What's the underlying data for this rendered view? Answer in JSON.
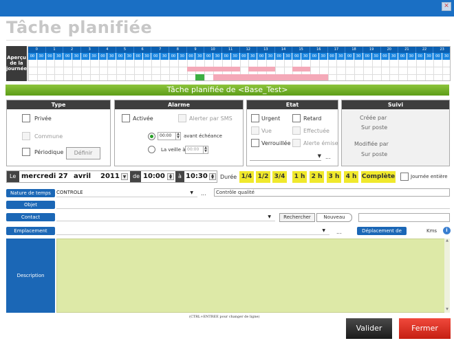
{
  "window": {
    "title": "Tâche planifiée",
    "close_icon": "close-icon"
  },
  "timeline": {
    "label": "Aperçu de la journée",
    "hours": [
      "0",
      "1",
      "2",
      "3",
      "4",
      "5",
      "6",
      "7",
      "8",
      "9",
      "10",
      "11",
      "12",
      "13",
      "14",
      "15",
      "16",
      "17",
      "18",
      "19",
      "20",
      "21",
      "22",
      "23"
    ],
    "minutes": [
      "00",
      "30"
    ],
    "busy_blocks": [
      {
        "start": 9.0,
        "end": 12.0,
        "row": 1,
        "color": "#f4a9b8"
      },
      {
        "start": 12.5,
        "end": 14.0,
        "row": 1,
        "color": "#f4a9b8"
      },
      {
        "start": 15.0,
        "end": 16.0,
        "row": 1,
        "color": "#f4a9b8"
      },
      {
        "start": 10.5,
        "end": 17.0,
        "row": 2,
        "color": "#f4a9b8"
      },
      {
        "start": 9.5,
        "end": 10.0,
        "row": 2,
        "color": "#3cb043"
      }
    ]
  },
  "header_band": "Tâche planifiée de <Base_Test>",
  "type_panel": {
    "title": "Type",
    "privee": "Privée",
    "commune": "Commune",
    "periodique": "Périodique",
    "definir": "Définir"
  },
  "alarme_panel": {
    "title": "Alarme",
    "activee": "Activée",
    "alerter_sms": "Alerter par SMS",
    "time_value": "00:00",
    "avant_echeance": "avant échéance",
    "veille": "La veille à",
    "veille_time": "00:00"
  },
  "etat_panel": {
    "title": "Etat",
    "urgent": "Urgent",
    "retard": "Retard",
    "vue": "Vue",
    "effectuee": "Effectuée",
    "verrouillee": "Verrouillée",
    "alerte_emise": "Alerte émise",
    "ellipsis": "..."
  },
  "suivi_panel": {
    "title": "Suivi",
    "creee_par": "Créée par",
    "sur_poste_1": "Sur poste",
    "modifiee_par": "Modifiée par",
    "sur_poste_2": "Sur poste"
  },
  "date_bar": {
    "le": "Le",
    "day": "mercredi 27",
    "month": "avril",
    "year": "2011",
    "de": "de",
    "start": "10:00",
    "a": "à",
    "end": "10:30"
  },
  "duree": {
    "label": "Durée",
    "options": [
      "1/4",
      "1/2",
      "3/4",
      "1 h",
      "2 h",
      "3 h",
      "4 h",
      "Complète"
    ],
    "journee_entiere": "Journée entière"
  },
  "fields": {
    "nature_label": "Nature de temps",
    "nature_value": "CONTROLE",
    "nature_detail": "Contrôle qualité",
    "objet_label": "Objet",
    "contact_label": "Contact",
    "rechercher": "Rechercher",
    "nouveau": "Nouveau",
    "emplacement_label": "Emplacement",
    "deplacement": "Déplacement de",
    "kms": "Kms",
    "ellipsis": "..."
  },
  "description": {
    "label": "Description",
    "hint": "(CTRL+ENTREE pour changer de ligne)"
  },
  "buttons": {
    "valider": "Valider",
    "fermer": "Fermer"
  }
}
